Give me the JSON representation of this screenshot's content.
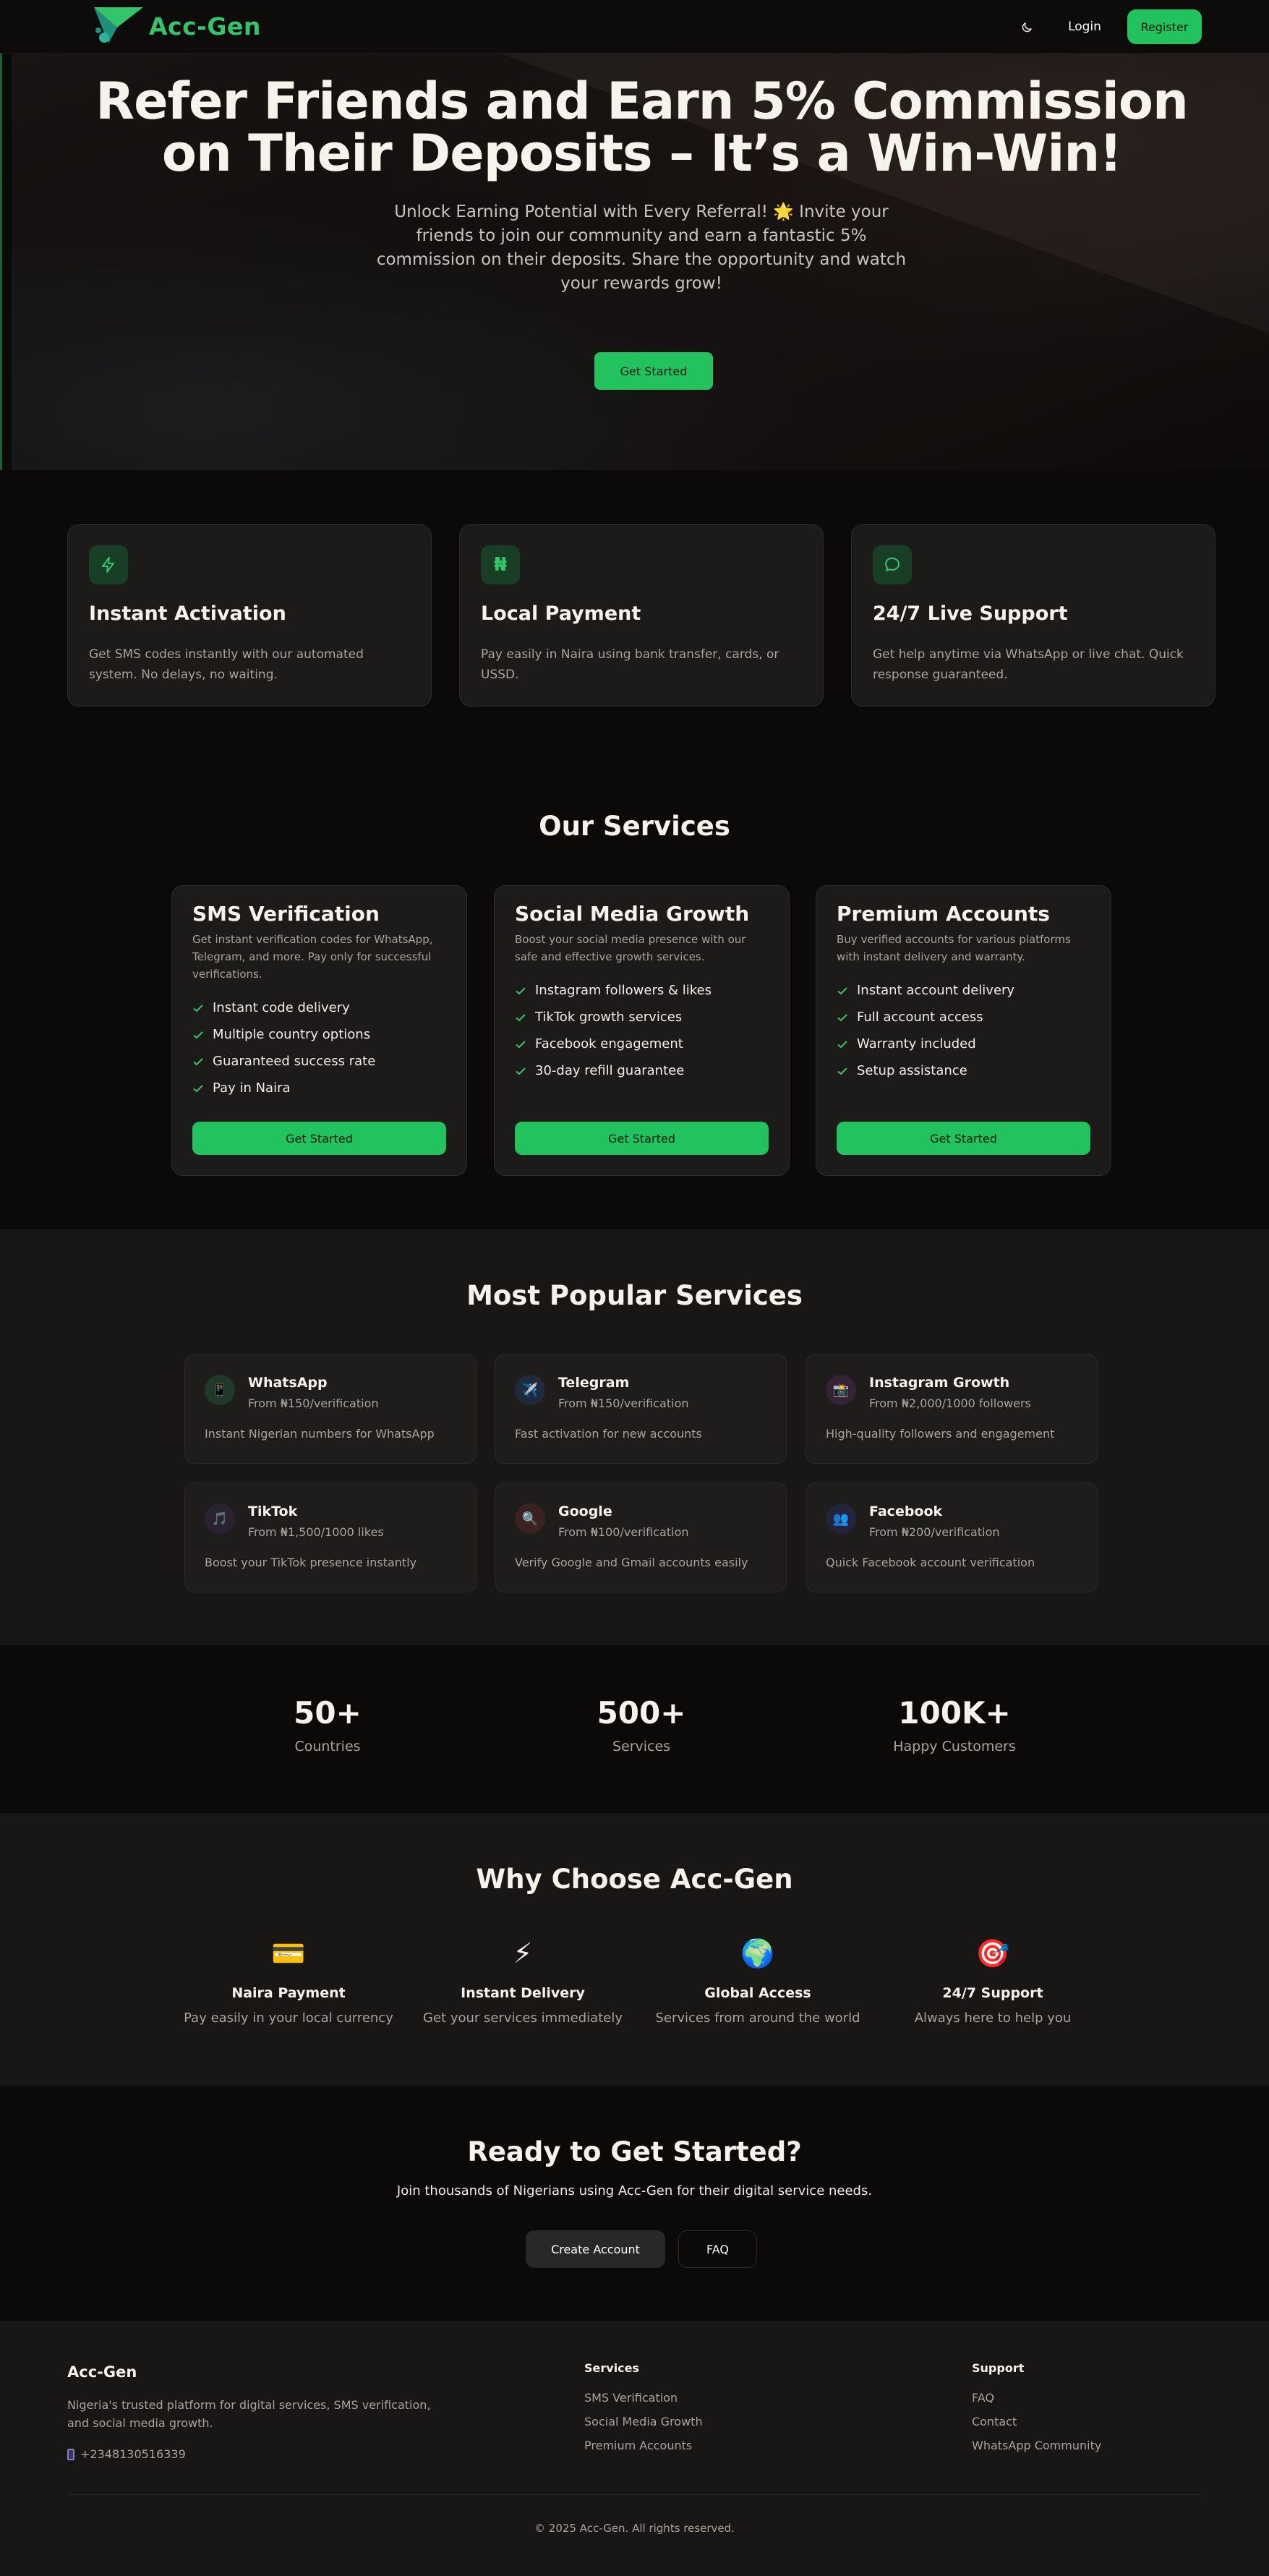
{
  "nav": {
    "brand": "Acc-Gen",
    "login_label": "Login",
    "register_label": "Register"
  },
  "hero": {
    "title": "Refer Friends and Earn 5% Commission on Their Deposits – It’s a Win-Win!",
    "subtitle": "Unlock Earning Potential with Every Referral! 🌟 Invite your friends to join our community and earn a fantastic 5% commission on their deposits. Share the opportunity and watch your rewards grow!",
    "cta_label": "Get Started"
  },
  "features": [
    {
      "icon": "lightning-icon",
      "title": "Instant Activation",
      "desc": "Get SMS codes instantly with our automated system. No delays, no waiting."
    },
    {
      "icon": "naira-icon",
      "title": "Local Payment",
      "desc": "Pay easily in Naira using bank transfer, cards, or USSD."
    },
    {
      "icon": "chat-bubble-icon",
      "title": "24/7 Live Support",
      "desc": "Get help anytime via WhatsApp or live chat. Quick response guaranteed."
    }
  ],
  "services": {
    "title": "Our Services",
    "cards": [
      {
        "title": "SMS Verification",
        "desc": "Get instant verification codes for WhatsApp, Telegram, and more. Pay only for successful verifications.",
        "items": [
          "Instant code delivery",
          "Multiple country options",
          "Guaranteed success rate",
          "Pay in Naira"
        ],
        "button": "Get Started"
      },
      {
        "title": "Social Media Growth",
        "desc": "Boost your social media presence with our safe and effective growth services.",
        "items": [
          "Instagram followers & likes",
          "TikTok growth services",
          "Facebook engagement",
          "30-day refill guarantee"
        ],
        "button": "Get Started"
      },
      {
        "title": "Premium Accounts",
        "desc": "Buy verified accounts for various platforms with instant delivery and warranty.",
        "items": [
          "Instant account delivery",
          "Full account access",
          "Warranty included",
          "Setup assistance"
        ],
        "button": "Get Started"
      }
    ]
  },
  "popular": {
    "title": "Most Popular Services",
    "items": [
      {
        "name": "WhatsApp",
        "price": "From ₦150/verification",
        "desc": "Instant Nigerian numbers for WhatsApp",
        "icon": "phone-icon",
        "glyph": "📱",
        "color": "#1f3a28"
      },
      {
        "name": "Telegram",
        "price": "From ₦150/verification",
        "desc": "Fast activation for new accounts",
        "icon": "airplane-icon",
        "glyph": "✈️",
        "color": "#1f2b3d"
      },
      {
        "name": "Instagram Growth",
        "price": "From ₦2,000/1000 followers",
        "desc": "High-quality followers and engagement",
        "icon": "camera-icon",
        "glyph": "📸",
        "color": "#352236"
      },
      {
        "name": "TikTok",
        "price": "From ₦1,500/1000 likes",
        "desc": "Boost your TikTok presence instantly",
        "icon": "music-note-icon",
        "glyph": "🎵",
        "color": "#2a2230"
      },
      {
        "name": "Google",
        "price": "From ₦100/verification",
        "desc": "Verify Google and Gmail accounts easily",
        "icon": "magnifier-icon",
        "glyph": "🔍",
        "color": "#3a2220"
      },
      {
        "name": "Facebook",
        "price": "From ₦200/verification",
        "desc": "Quick Facebook account verification",
        "icon": "people-icon",
        "glyph": "👥",
        "color": "#22243a"
      }
    ]
  },
  "stats": [
    {
      "value": "50+",
      "label": "Countries"
    },
    {
      "value": "500+",
      "label": "Services"
    },
    {
      "value": "100K+",
      "label": "Happy Customers"
    }
  ],
  "why": {
    "title": "Why Choose Acc-Gen",
    "items": [
      {
        "icon": "credit-card-icon",
        "glyph": "💳",
        "title": "Naira Payment",
        "desc": "Pay easily in your local currency"
      },
      {
        "icon": "lightning-icon",
        "glyph": "⚡",
        "title": "Instant Delivery",
        "desc": "Get your services immediately"
      },
      {
        "icon": "globe-icon",
        "glyph": "🌍",
        "title": "Global Access",
        "desc": "Services from around the world"
      },
      {
        "icon": "target-icon",
        "glyph": "🎯",
        "title": "24/7 Support",
        "desc": "Always here to help you"
      }
    ]
  },
  "cta": {
    "title": "Ready to Get Started?",
    "subtitle": "Join thousands of Nigerians using Acc-Gen for their digital service needs.",
    "create_label": "Create Account",
    "faq_label": "FAQ"
  },
  "footer": {
    "brand": "Acc-Gen",
    "desc": "Nigeria's trusted platform for digital services, SMS verification, and social media growth.",
    "phone": "+2348130516339",
    "services_heading": "Services",
    "services_links": [
      "SMS Verification",
      "Social Media Growth",
      "Premium Accounts"
    ],
    "support_heading": "Support",
    "support_links": [
      "FAQ",
      "Contact",
      "WhatsApp Community"
    ],
    "copyright": "© 2025 Acc-Gen. All rights reserved."
  },
  "colors": {
    "accent": "#22c35e",
    "background": "#0b0a09",
    "card": "#1d1b19"
  }
}
